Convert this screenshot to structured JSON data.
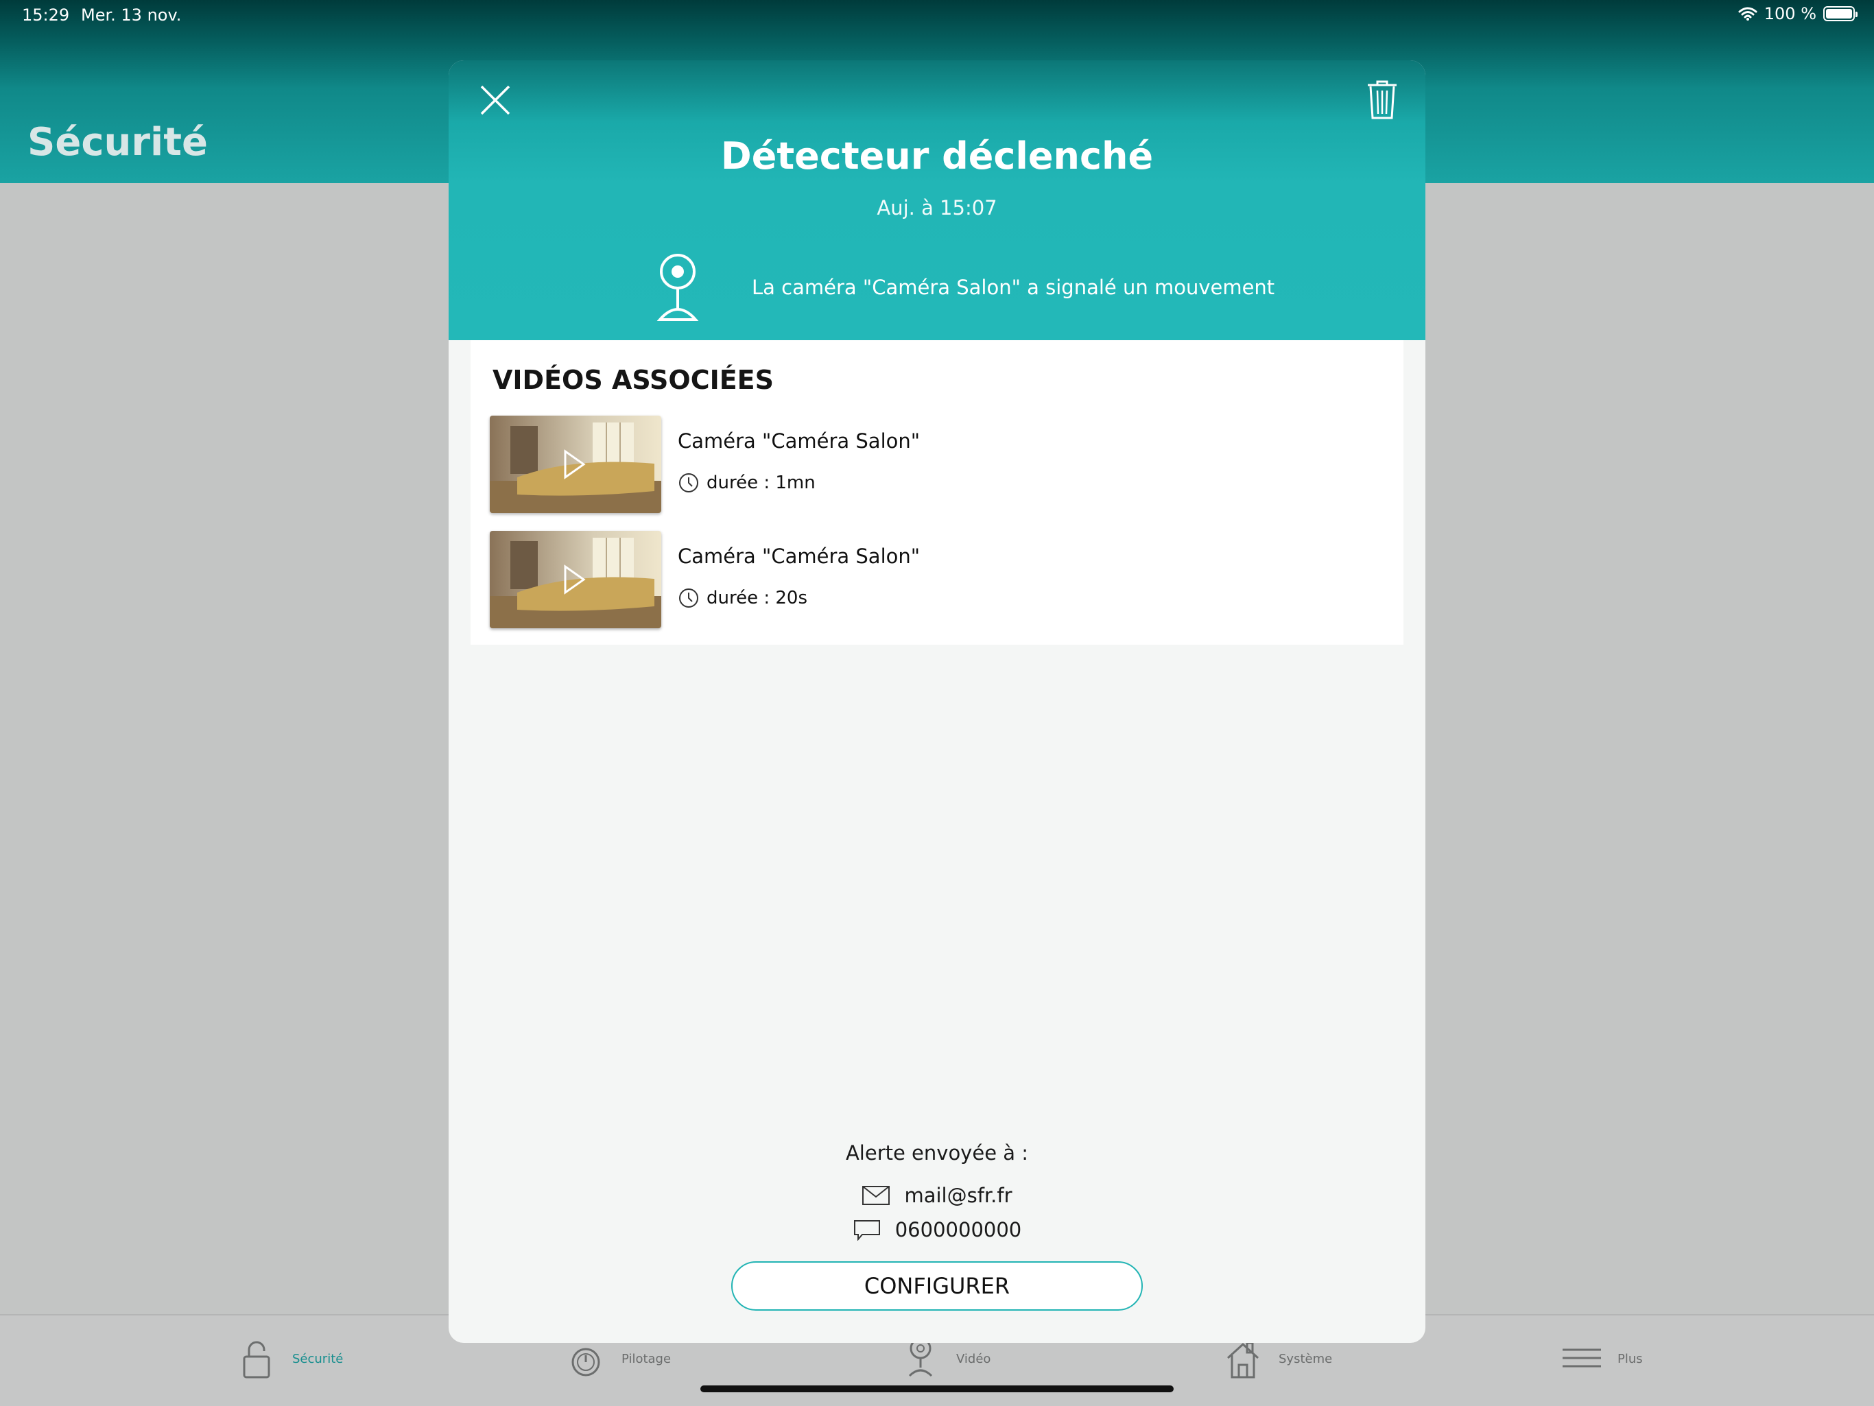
{
  "status_bar": {
    "time": "15:29",
    "date": "Mer. 13 nov.",
    "battery": "100 %"
  },
  "header": {
    "title": "Sécurité"
  },
  "modal": {
    "title": "Détecteur déclenché",
    "date": "Auj. à 15:07",
    "message": "La caméra \"Caméra Salon\" a signalé un mouvement",
    "videos_title": "VIDÉOS ASSOCIÉES",
    "videos": [
      {
        "name": "Caméra \"Caméra Salon\"",
        "duration": "durée : 1mn"
      },
      {
        "name": "Caméra \"Caméra Salon\"",
        "duration": "durée : 20s"
      }
    ],
    "alert_label": "Alerte envoyée à :",
    "email": "mail@sfr.fr",
    "phone": "0600000000",
    "configure_label": "CONFIGURER"
  },
  "tabs": [
    {
      "label": "Sécurité",
      "icon": "lock-icon",
      "active": true
    },
    {
      "label": "Pilotage",
      "icon": "power-icon",
      "active": false
    },
    {
      "label": "Vidéo",
      "icon": "camera-icon",
      "active": false
    },
    {
      "label": "Système",
      "icon": "house-icon",
      "active": false
    },
    {
      "label": "Plus",
      "icon": "menu-icon",
      "active": false
    }
  ],
  "colors": {
    "accent": "#23b8b8",
    "header_dark": "#055e5e",
    "active_tab": "#168e8e"
  }
}
